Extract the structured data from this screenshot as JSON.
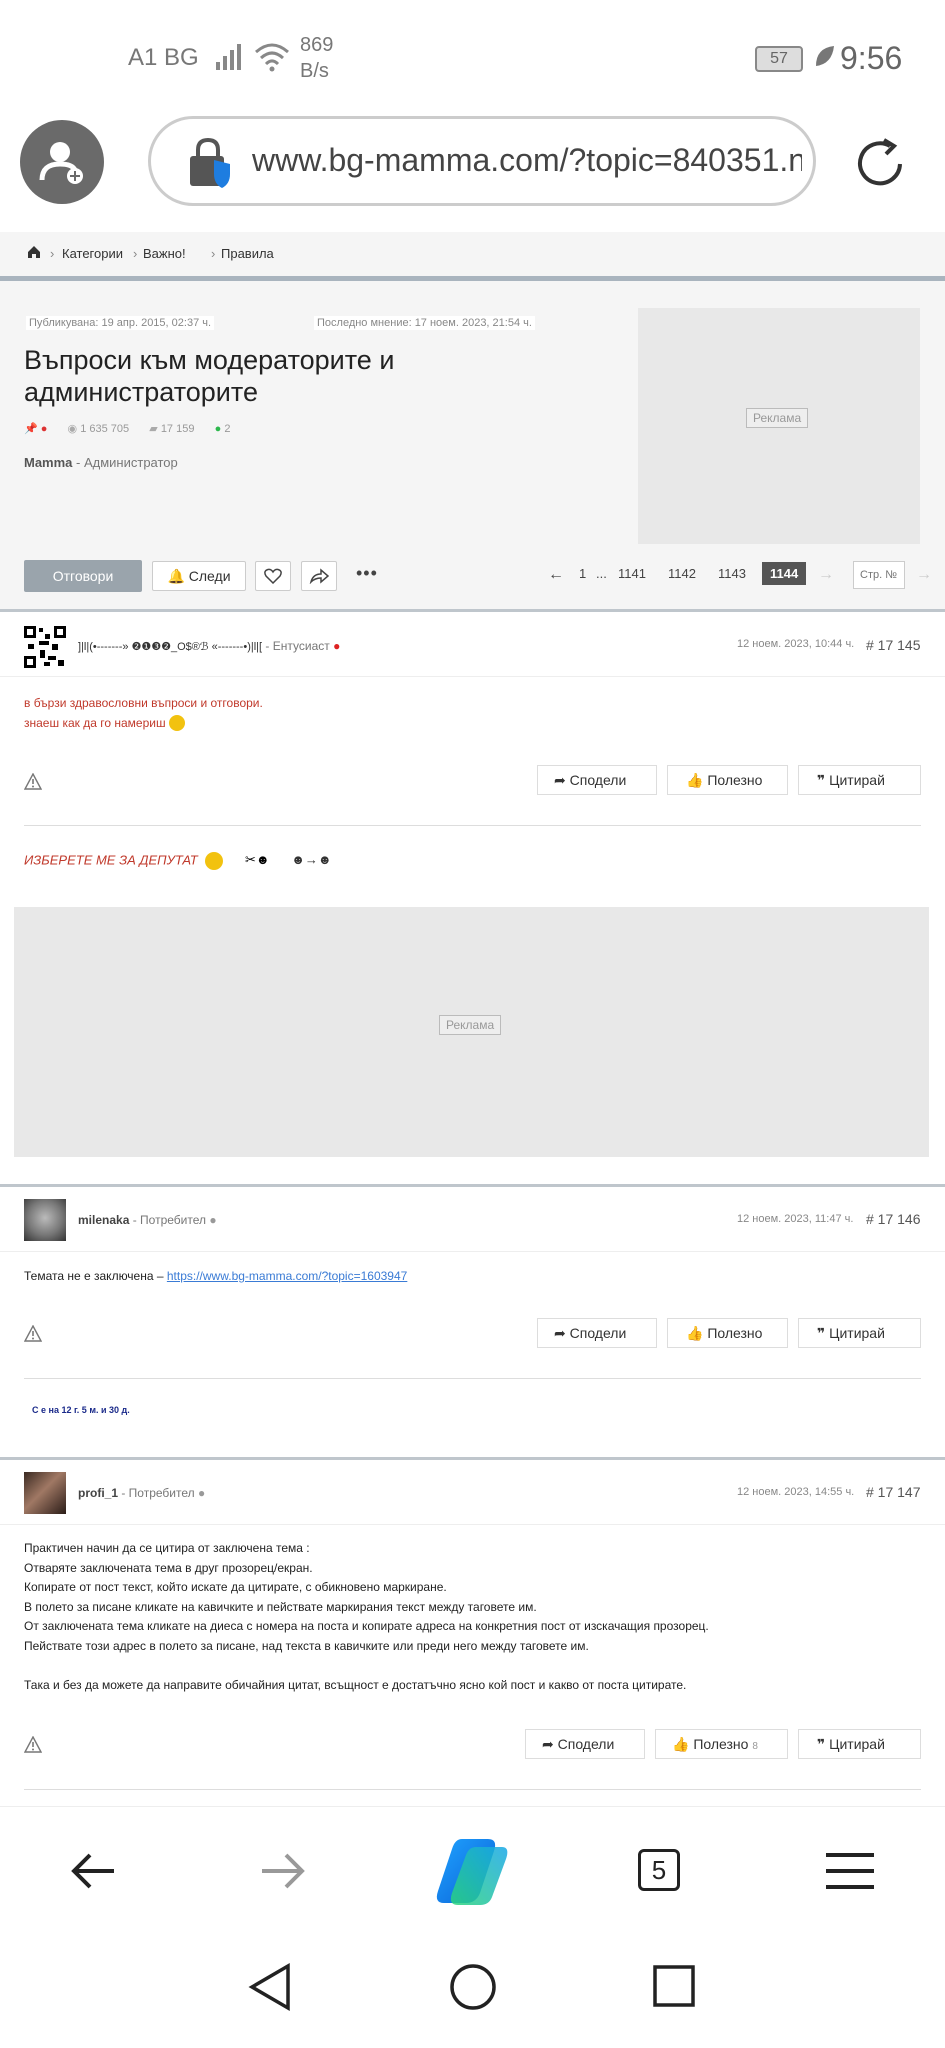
{
  "status": {
    "carrier": "A1 BG",
    "speed_value": "869",
    "speed_unit": "B/s",
    "battery": "57",
    "time": "9:56"
  },
  "browser": {
    "url": "www.bg-mamma.com/?topic=840351.n",
    "tab_count": "5"
  },
  "breadcrumb": [
    "Категории",
    "Важно!",
    "Правила"
  ],
  "topic": {
    "published": "Публикувана: 19 апр. 2015, 02:37 ч.",
    "last_opinion": "Последно мнение: 17 ноем. 2023, 21:54 ч.",
    "title": "Въпроси към модераторите и администраторите",
    "views": "1 635 705",
    "replies": "17 159",
    "online": "2",
    "author_name": "Mamma",
    "author_role": " - Администратор",
    "ad_label": "Реклама"
  },
  "toolbar": {
    "reply": "Отговори",
    "follow": "Следи",
    "pages": [
      "1",
      "...",
      "1141",
      "1142",
      "1143"
    ],
    "current_page": "1144",
    "page_input_placeholder": "Стр. №"
  },
  "actions": {
    "share": "Сподели",
    "useful": "Полезно",
    "quote": "Цитирай"
  },
  "posts": [
    {
      "user": "]|l|(•-------» ❷❶❸❷_O$®ℬ «-------•)|l|[",
      "role": " - Ентусиаст",
      "date": "12 ноем. 2023, 10:44 ч.",
      "num": "# 17 145",
      "line1": "в бързи здравословни въпроси и отговори.",
      "line2": "знаеш как да го намериш",
      "signature": "ИЗБЕРЕТЕ МЕ ЗА  ДЕПУТАТ"
    },
    {
      "user": "milenaka",
      "role": " - Потребител",
      "date": "12 ноем. 2023, 11:47 ч.",
      "num": "# 17 146",
      "text": "Темата не е заключена – ",
      "link": "https://www.bg-mamma.com/?topic=1603947",
      "signature": "С е на 12 г. 5 м. и 30 д."
    },
    {
      "user": "profi_1",
      "role": " - Потребител",
      "date": "12 ноем. 2023, 14:55 ч.",
      "num": "# 17 147",
      "lines": [
        "Практичен начин да се цитира от заключена тема :",
        "Отваряте заключената тема в друг прозорец/екран.",
        "Копирате от пост текст, който искате да цитирате, с обикновено маркиране.",
        "В полето за писане кликате на кавичките и пействате маркирания текст между таговете им.",
        "От заключената тема кликате на диеса с номера на поста и копирате адреса на конкретния пост от изскачащия прозорец.",
        "Пействате този адрес в полето за писане, над текста в кавичките или преди него между таговете им.",
        "",
        "Така и без да можете да направите обичайния цитат, всъщност е достатъчно ясно кой пост и какво от поста цитирате."
      ],
      "useful_count": "8"
    }
  ],
  "ad_label": "Реклама"
}
